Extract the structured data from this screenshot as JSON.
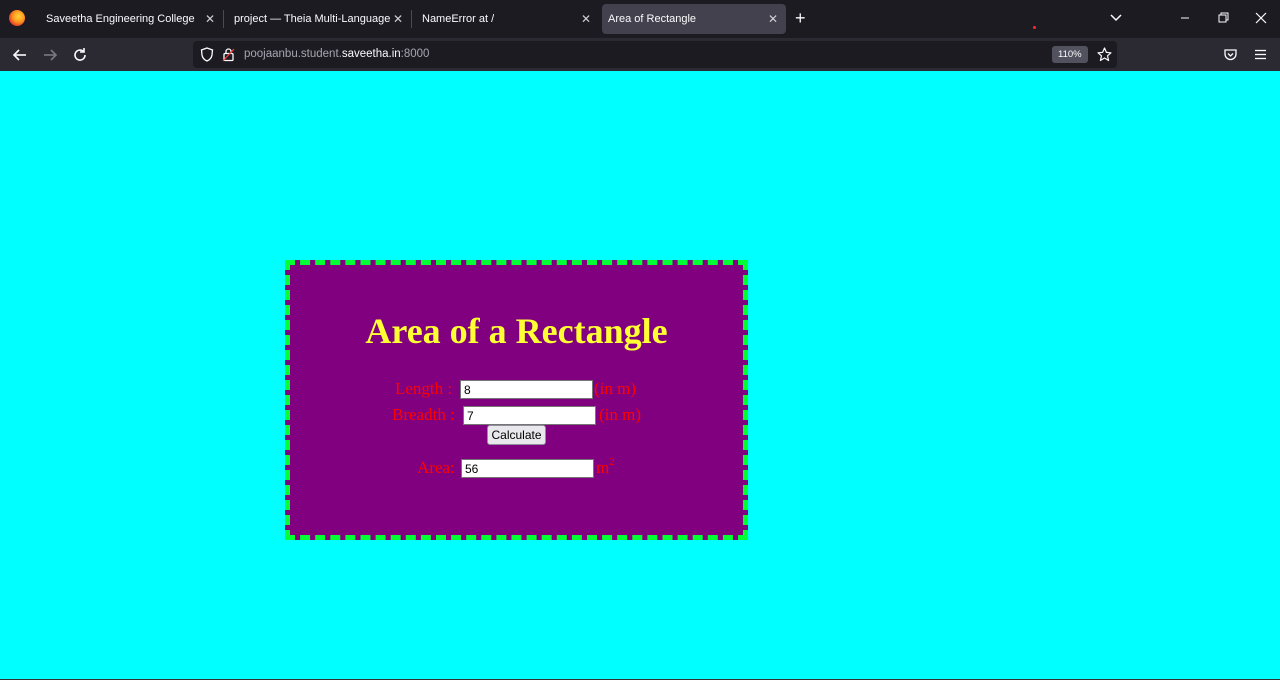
{
  "browser": {
    "tabs": [
      {
        "title": "Saveetha Engineering College",
        "active": false
      },
      {
        "title": "project — Theia Multi-Language Ex",
        "active": false
      },
      {
        "title": "NameError at /",
        "active": false
      },
      {
        "title": "Area of Rectangle",
        "active": true
      }
    ],
    "url_prefix": "poojaanbu.student.",
    "url_domain": "saveetha.in",
    "url_suffix": ":8000",
    "zoom": "110%"
  },
  "page": {
    "heading": "Area of a Rectangle",
    "length_label": "Length :",
    "length_value": "8",
    "length_unit": "(in m)",
    "breadth_label": "Breadth :",
    "breadth_value": "7",
    "breadth_unit": "(in m)",
    "calculate_label": "Calculate",
    "area_label": "Area:",
    "area_value": "56",
    "area_unit": "m",
    "area_unit_sup": "2"
  },
  "colors": {
    "page_background": "#00ffff",
    "card_background": "#800080",
    "card_border": "#00ff33",
    "heading": "#ffff33",
    "labels": "#ff0000"
  }
}
